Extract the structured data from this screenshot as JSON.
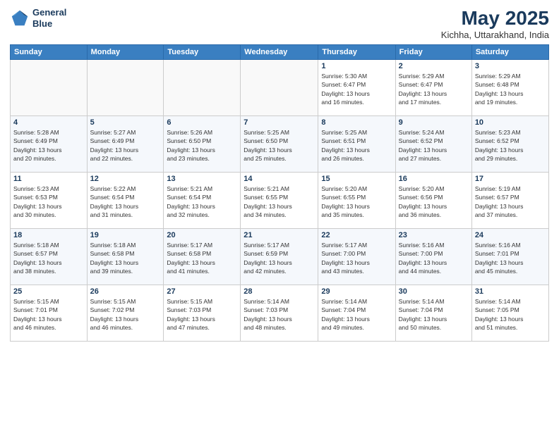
{
  "header": {
    "logo_line1": "General",
    "logo_line2": "Blue",
    "month": "May 2025",
    "location": "Kichha, Uttarakhand, India"
  },
  "days_of_week": [
    "Sunday",
    "Monday",
    "Tuesday",
    "Wednesday",
    "Thursday",
    "Friday",
    "Saturday"
  ],
  "weeks": [
    [
      {
        "num": "",
        "info": ""
      },
      {
        "num": "",
        "info": ""
      },
      {
        "num": "",
        "info": ""
      },
      {
        "num": "",
        "info": ""
      },
      {
        "num": "1",
        "info": "Sunrise: 5:30 AM\nSunset: 6:47 PM\nDaylight: 13 hours\nand 16 minutes."
      },
      {
        "num": "2",
        "info": "Sunrise: 5:29 AM\nSunset: 6:47 PM\nDaylight: 13 hours\nand 17 minutes."
      },
      {
        "num": "3",
        "info": "Sunrise: 5:29 AM\nSunset: 6:48 PM\nDaylight: 13 hours\nand 19 minutes."
      }
    ],
    [
      {
        "num": "4",
        "info": "Sunrise: 5:28 AM\nSunset: 6:49 PM\nDaylight: 13 hours\nand 20 minutes."
      },
      {
        "num": "5",
        "info": "Sunrise: 5:27 AM\nSunset: 6:49 PM\nDaylight: 13 hours\nand 22 minutes."
      },
      {
        "num": "6",
        "info": "Sunrise: 5:26 AM\nSunset: 6:50 PM\nDaylight: 13 hours\nand 23 minutes."
      },
      {
        "num": "7",
        "info": "Sunrise: 5:25 AM\nSunset: 6:50 PM\nDaylight: 13 hours\nand 25 minutes."
      },
      {
        "num": "8",
        "info": "Sunrise: 5:25 AM\nSunset: 6:51 PM\nDaylight: 13 hours\nand 26 minutes."
      },
      {
        "num": "9",
        "info": "Sunrise: 5:24 AM\nSunset: 6:52 PM\nDaylight: 13 hours\nand 27 minutes."
      },
      {
        "num": "10",
        "info": "Sunrise: 5:23 AM\nSunset: 6:52 PM\nDaylight: 13 hours\nand 29 minutes."
      }
    ],
    [
      {
        "num": "11",
        "info": "Sunrise: 5:23 AM\nSunset: 6:53 PM\nDaylight: 13 hours\nand 30 minutes."
      },
      {
        "num": "12",
        "info": "Sunrise: 5:22 AM\nSunset: 6:54 PM\nDaylight: 13 hours\nand 31 minutes."
      },
      {
        "num": "13",
        "info": "Sunrise: 5:21 AM\nSunset: 6:54 PM\nDaylight: 13 hours\nand 32 minutes."
      },
      {
        "num": "14",
        "info": "Sunrise: 5:21 AM\nSunset: 6:55 PM\nDaylight: 13 hours\nand 34 minutes."
      },
      {
        "num": "15",
        "info": "Sunrise: 5:20 AM\nSunset: 6:55 PM\nDaylight: 13 hours\nand 35 minutes."
      },
      {
        "num": "16",
        "info": "Sunrise: 5:20 AM\nSunset: 6:56 PM\nDaylight: 13 hours\nand 36 minutes."
      },
      {
        "num": "17",
        "info": "Sunrise: 5:19 AM\nSunset: 6:57 PM\nDaylight: 13 hours\nand 37 minutes."
      }
    ],
    [
      {
        "num": "18",
        "info": "Sunrise: 5:18 AM\nSunset: 6:57 PM\nDaylight: 13 hours\nand 38 minutes."
      },
      {
        "num": "19",
        "info": "Sunrise: 5:18 AM\nSunset: 6:58 PM\nDaylight: 13 hours\nand 39 minutes."
      },
      {
        "num": "20",
        "info": "Sunrise: 5:17 AM\nSunset: 6:58 PM\nDaylight: 13 hours\nand 41 minutes."
      },
      {
        "num": "21",
        "info": "Sunrise: 5:17 AM\nSunset: 6:59 PM\nDaylight: 13 hours\nand 42 minutes."
      },
      {
        "num": "22",
        "info": "Sunrise: 5:17 AM\nSunset: 7:00 PM\nDaylight: 13 hours\nand 43 minutes."
      },
      {
        "num": "23",
        "info": "Sunrise: 5:16 AM\nSunset: 7:00 PM\nDaylight: 13 hours\nand 44 minutes."
      },
      {
        "num": "24",
        "info": "Sunrise: 5:16 AM\nSunset: 7:01 PM\nDaylight: 13 hours\nand 45 minutes."
      }
    ],
    [
      {
        "num": "25",
        "info": "Sunrise: 5:15 AM\nSunset: 7:01 PM\nDaylight: 13 hours\nand 46 minutes."
      },
      {
        "num": "26",
        "info": "Sunrise: 5:15 AM\nSunset: 7:02 PM\nDaylight: 13 hours\nand 46 minutes."
      },
      {
        "num": "27",
        "info": "Sunrise: 5:15 AM\nSunset: 7:03 PM\nDaylight: 13 hours\nand 47 minutes."
      },
      {
        "num": "28",
        "info": "Sunrise: 5:14 AM\nSunset: 7:03 PM\nDaylight: 13 hours\nand 48 minutes."
      },
      {
        "num": "29",
        "info": "Sunrise: 5:14 AM\nSunset: 7:04 PM\nDaylight: 13 hours\nand 49 minutes."
      },
      {
        "num": "30",
        "info": "Sunrise: 5:14 AM\nSunset: 7:04 PM\nDaylight: 13 hours\nand 50 minutes."
      },
      {
        "num": "31",
        "info": "Sunrise: 5:14 AM\nSunset: 7:05 PM\nDaylight: 13 hours\nand 51 minutes."
      }
    ]
  ]
}
